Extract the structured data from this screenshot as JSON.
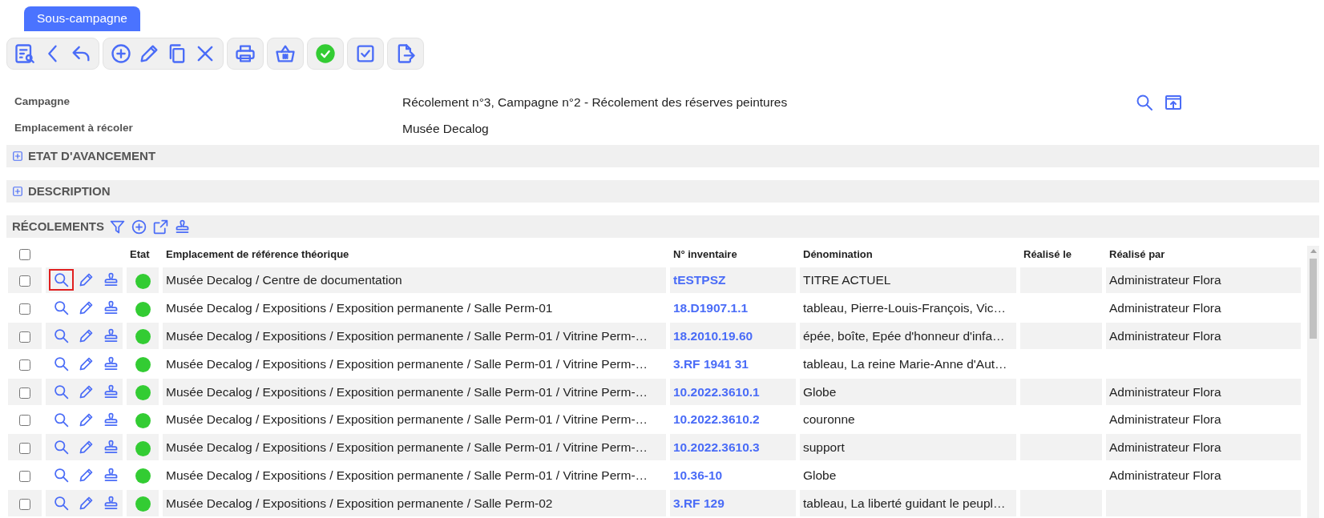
{
  "tab": {
    "label": "Sous-campagne",
    "selected": true
  },
  "toolbar": [
    [
      {
        "kind": "document-search"
      },
      {
        "kind": "back"
      },
      {
        "kind": "undo"
      }
    ],
    [
      {
        "kind": "add"
      },
      {
        "kind": "edit"
      },
      {
        "kind": "copy"
      },
      {
        "kind": "delete"
      }
    ],
    [
      {
        "kind": "print"
      }
    ],
    [
      {
        "kind": "basket"
      }
    ],
    [
      {
        "kind": "validate"
      }
    ],
    [
      {
        "kind": "checkbox"
      }
    ],
    [
      {
        "kind": "export"
      }
    ]
  ],
  "fields": [
    {
      "label": "Campagne",
      "value": "Récolement n°3, Campagne n°2 - Récolement des réserves peintures"
    },
    {
      "label": "Emplacement à récoler",
      "value": "Musée Decalog"
    }
  ],
  "field_actions": [
    {
      "kind": "search"
    },
    {
      "kind": "open-window"
    }
  ],
  "sections": [
    {
      "title": "ETAT D'AVANCEMENT",
      "expanded": false
    },
    {
      "title": "DESCRIPTION",
      "expanded": false
    }
  ],
  "recolements": {
    "title": "RÉCOLEMENTS",
    "actions": [
      {
        "kind": "filter"
      },
      {
        "kind": "add"
      },
      {
        "kind": "external"
      },
      {
        "kind": "stamp"
      }
    ],
    "select_all_checked": false,
    "columns": [
      "Etat",
      "Emplacement de référence théorique",
      "N° inventaire",
      "Dénomination",
      "Réalisé le",
      "Réalisé par"
    ],
    "rows": [
      {
        "checked": false,
        "focused": true,
        "color": "#33cc33",
        "emplacement": "Musée Decalog / Centre de documentation",
        "inventaire": "tESTPSZ",
        "denomination": "TITRE ACTUEL",
        "realise_par": "Administrateur Flora"
      },
      {
        "checked": false,
        "focused": false,
        "color": "#33cc33",
        "emplacement": "Musée Decalog / Expositions / Exposition permanente / Salle Perm-01",
        "inventaire": "18.D1907.1.1",
        "denomination": "tableau, Pierre-Louis-François, Vic…",
        "realise_par": "Administrateur Flora"
      },
      {
        "checked": false,
        "focused": false,
        "color": "#33cc33",
        "emplacement": "Musée Decalog / Expositions / Exposition permanente / Salle Perm-01 / Vitrine Perm-…",
        "inventaire": "18.2010.19.60",
        "denomination": "épée, boîte, Epée d'honneur d'infa…",
        "realise_par": "Administrateur Flora"
      },
      {
        "checked": false,
        "focused": false,
        "color": "#33cc33",
        "emplacement": "Musée Decalog / Expositions / Exposition permanente / Salle Perm-01 / Vitrine Perm-…",
        "inventaire": "3.RF 1941 31",
        "denomination": "tableau, La reine Marie-Anne d'Aut…"
      },
      {
        "checked": false,
        "focused": false,
        "color": "#33cc33",
        "emplacement": "Musée Decalog / Expositions / Exposition permanente / Salle Perm-01 / Vitrine Perm-…",
        "inventaire": "10.2022.3610.1",
        "denomination": "Globe",
        "realise_par": "Administrateur Flora"
      },
      {
        "checked": false,
        "focused": false,
        "color": "#33cc33",
        "emplacement": "Musée Decalog / Expositions / Exposition permanente / Salle Perm-01 / Vitrine Perm-…",
        "inventaire": "10.2022.3610.2",
        "denomination": "couronne",
        "realise_par": "Administrateur Flora"
      },
      {
        "checked": false,
        "focused": false,
        "color": "#33cc33",
        "emplacement": "Musée Decalog / Expositions / Exposition permanente / Salle Perm-01 / Vitrine Perm-…",
        "inventaire": "10.2022.3610.3",
        "denomination": "support",
        "realise_par": "Administrateur Flora"
      },
      {
        "checked": false,
        "focused": false,
        "color": "#33cc33",
        "emplacement": "Musée Decalog / Expositions / Exposition permanente / Salle Perm-01 / Vitrine Perm-…",
        "inventaire": "10.36-10",
        "denomination": "Globe",
        "realise_par": "Administrateur Flora"
      },
      {
        "checked": false,
        "focused": false,
        "color": "#33cc33",
        "emplacement": "Musée Decalog / Expositions / Exposition permanente / Salle Perm-02",
        "inventaire": "3.RF 129",
        "denomination": "tableau, La liberté guidant le peupl…"
      }
    ]
  }
}
